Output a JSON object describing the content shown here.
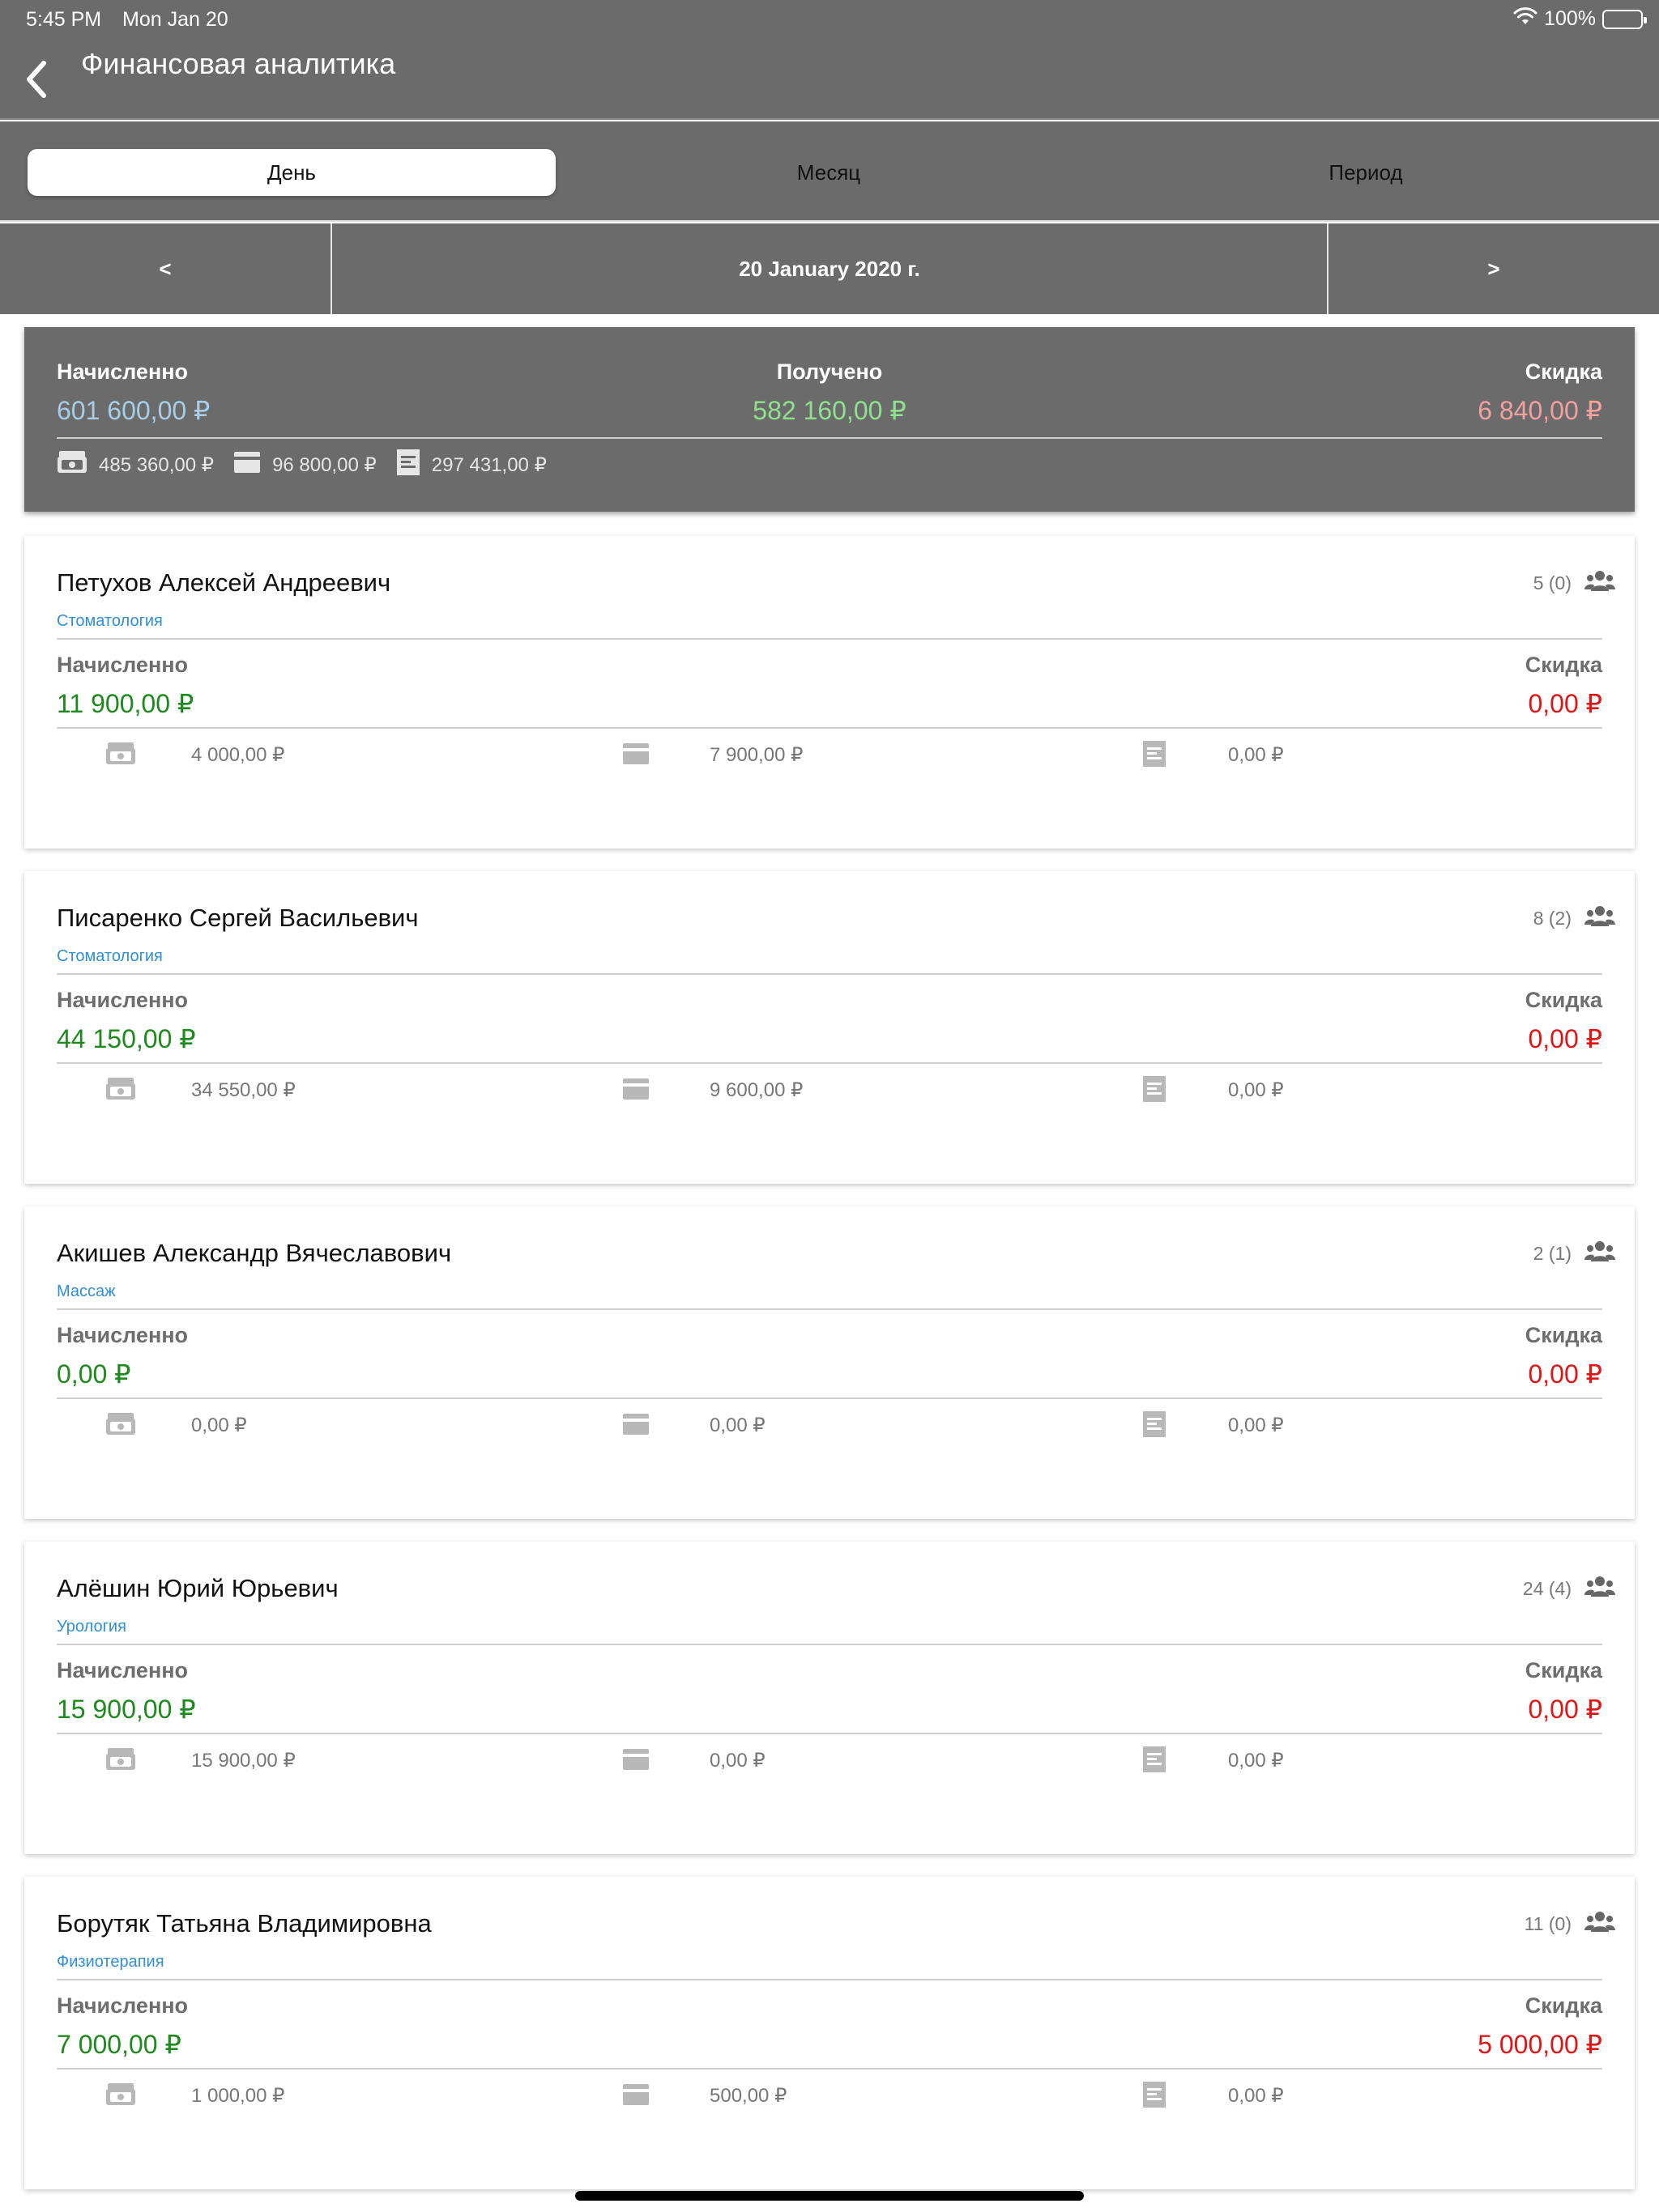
{
  "status_bar": {
    "time": "5:45 PM",
    "date": "Mon Jan 20",
    "battery": "100%"
  },
  "header": {
    "title": "Финансовая аналитика"
  },
  "tabs": [
    {
      "label": "День",
      "active": true
    },
    {
      "label": "Месяц",
      "active": false
    },
    {
      "label": "Период",
      "active": false
    }
  ],
  "date_nav": {
    "prev": "<",
    "current": "20 January 2020 г.",
    "next": ">"
  },
  "summary": {
    "accrued_label": "Начисленно",
    "accrued_value": "601 600,00 ₽",
    "received_label": "Получено",
    "received_value": "582 160,00 ₽",
    "discount_label": "Скидка",
    "discount_value": "6 840,00 ₽",
    "cash": "485 360,00 ₽",
    "card": "96 800,00 ₽",
    "other": "297 431,00 ₽",
    "colors": {
      "accrued": "#a8cde6",
      "received": "#8fe08f",
      "discount": "#f2a0a0"
    }
  },
  "labels": {
    "accrued": "Начисленно",
    "discount": "Скидка"
  },
  "doctors": [
    {
      "name": "Петухов  Алексей  Андреевич",
      "specialty": "Стоматология",
      "count": "5 (0)",
      "accrued": "11 900,00 ₽",
      "discount": "0,00 ₽",
      "cash": "4 000,00 ₽",
      "card": "7 900,00 ₽",
      "other": "0,00 ₽"
    },
    {
      "name": "Писаренко Сергей Васильевич",
      "specialty": "Стоматология",
      "count": "8 (2)",
      "accrued": "44 150,00 ₽",
      "discount": "0,00 ₽",
      "cash": "34 550,00 ₽",
      "card": "9 600,00 ₽",
      "other": "0,00 ₽"
    },
    {
      "name": "Акишев Александр Вячеславович",
      "specialty": "Массаж",
      "count": "2 (1)",
      "accrued": "0,00 ₽",
      "discount": "0,00 ₽",
      "cash": "0,00 ₽",
      "card": "0,00 ₽",
      "other": "0,00 ₽"
    },
    {
      "name": "Алёшин Юрий Юрьевич",
      "specialty": "Урология",
      "count": "24 (4)",
      "accrued": "15 900,00 ₽",
      "discount": "0,00 ₽",
      "cash": "15 900,00 ₽",
      "card": "0,00 ₽",
      "other": "0,00 ₽"
    },
    {
      "name": "Борутяк Татьяна Владимировна",
      "specialty": "Физиотерапия",
      "count": "11 (0)",
      "accrued": "7 000,00 ₽",
      "discount": "5 000,00 ₽",
      "cash": "1 000,00 ₽",
      "card": "500,00 ₽",
      "other": "0,00 ₽"
    }
  ],
  "icons": {
    "back": "chevron-left-icon",
    "cash": "cash-icon",
    "card": "credit-card-icon",
    "other": "receipt-icon",
    "patients": "people-icon",
    "wifi": "wifi-icon",
    "battery": "battery-icon"
  }
}
